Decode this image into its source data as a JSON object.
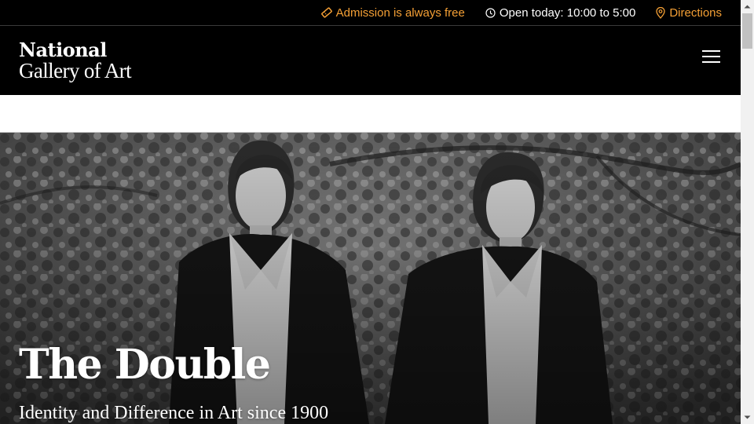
{
  "utility_bar": {
    "admission": "Admission is always free",
    "hours": "Open today: 10:00 to 5:00",
    "directions": "Directions"
  },
  "header": {
    "logo_line1": "National",
    "logo_line2": "Gallery of Art",
    "menu_icon": "hamburger-menu-icon"
  },
  "hero": {
    "title": "The Double",
    "subtitle": "Identity and Difference in Art since 1900"
  },
  "colors": {
    "accent": "#f5a035",
    "header_bg": "#000000",
    "text_light": "#ffffff"
  },
  "icons": {
    "admission": "ticket-icon",
    "hours": "clock-icon",
    "directions": "map-pin-icon"
  }
}
